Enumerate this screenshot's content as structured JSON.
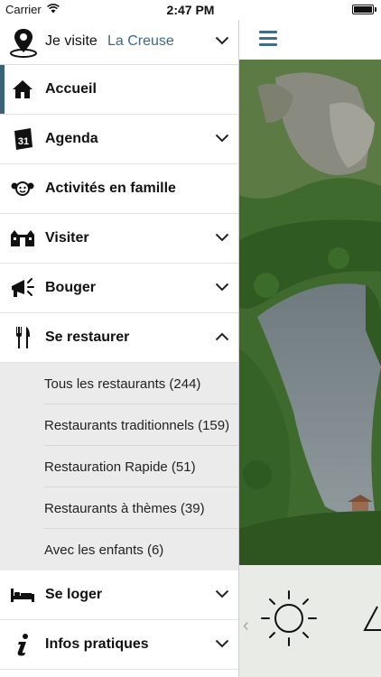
{
  "status_bar": {
    "carrier": "Carrier",
    "time": "2:47 PM"
  },
  "location_selector": {
    "label": "Je visite",
    "value": "La Creuse"
  },
  "menu": [
    {
      "label": "Accueil",
      "icon": "home-icon",
      "active": true,
      "has_chevron": false
    },
    {
      "label": "Agenda",
      "icon": "calendar-icon",
      "calendar_day": "31",
      "has_chevron": true,
      "chevron": "down"
    },
    {
      "label": "Activités en famille",
      "icon": "family-icon",
      "has_chevron": false
    },
    {
      "label": "Visiter",
      "icon": "building-icon",
      "has_chevron": true,
      "chevron": "down"
    },
    {
      "label": "Bouger",
      "icon": "megaphone-icon",
      "has_chevron": true,
      "chevron": "down"
    },
    {
      "label": "Se restaurer",
      "icon": "fork-knife-icon",
      "has_chevron": true,
      "chevron": "up",
      "expanded": true
    }
  ],
  "submenu": [
    "Tous les restaurants (244)",
    "Restaurants traditionnels (159)",
    "Restauration Rapide (51)",
    "Restaurants à thèmes (39)",
    "Avec les enfants (6)"
  ],
  "menu_bottom": [
    {
      "label": "Se loger",
      "icon": "bed-icon",
      "chevron": "down"
    },
    {
      "label": "Infos pratiques",
      "icon": "info-icon",
      "chevron": "down"
    }
  ],
  "colors": {
    "accent": "#3b6a80",
    "active_bar": "#3a6377",
    "submenu_bg": "#ebebeb"
  },
  "weather": {
    "icons": [
      "sun-icon",
      "warning-icon"
    ]
  }
}
